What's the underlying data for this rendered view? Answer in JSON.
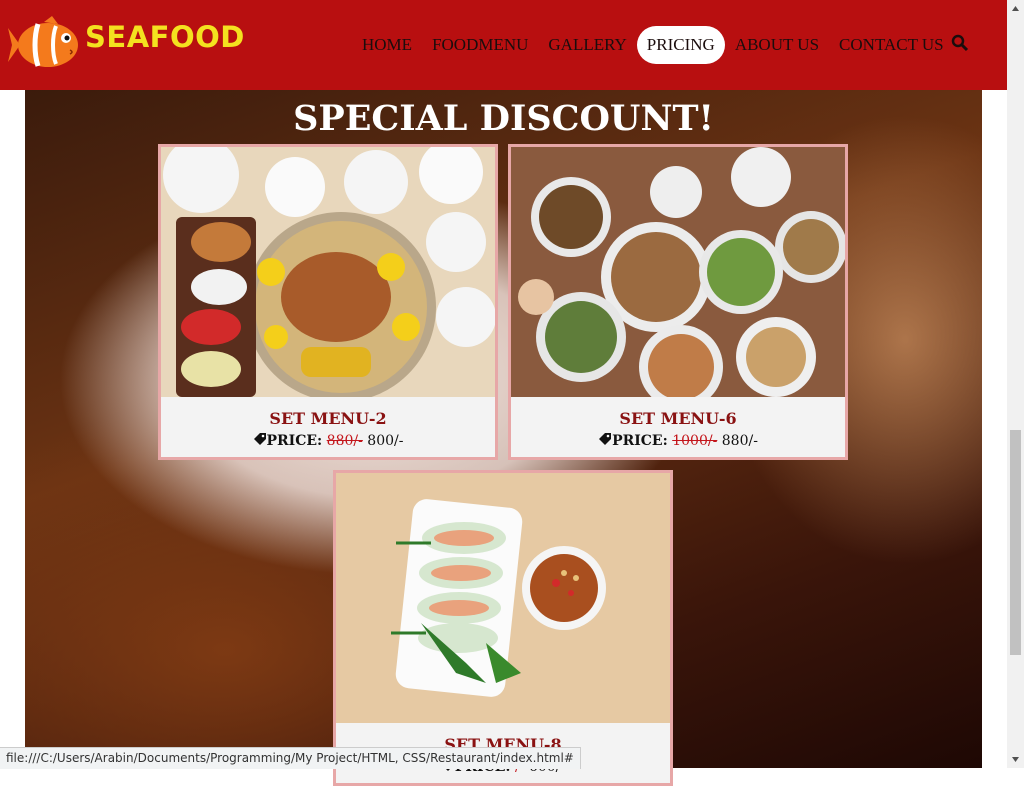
{
  "logo": {
    "text": "SEAFOOD"
  },
  "nav": {
    "items": [
      {
        "label": "HOME"
      },
      {
        "label": "FOODMENU"
      },
      {
        "label": "GALLERY"
      },
      {
        "label": "PRICING",
        "active": true
      },
      {
        "label": "ABOUT US"
      },
      {
        "label": "CONTACT US"
      }
    ],
    "search_icon": "search-icon"
  },
  "section": {
    "title": "SPECIAL DISCOUNT!"
  },
  "cards": [
    {
      "name": "SET MENU-2",
      "price_label": "PRICE:",
      "old_price": "880/-",
      "new_price": "800/-",
      "image": "platter-with-fries-chicken-rice"
    },
    {
      "name": "SET MENU-6",
      "price_label": "PRICE:",
      "old_price": "1000/-",
      "new_price": "880/-",
      "image": "table-of-assorted-dishes"
    },
    {
      "name": "SET MENU-8",
      "price_label": "PRICE:",
      "old_price": "/-",
      "new_price": "600/-",
      "image": "spring-rolls-with-dipping-sauce"
    }
  ],
  "colors": {
    "navbar": "#b80f10",
    "logo_text": "#f4e11f",
    "card_border": "#e7a7a7",
    "menu_name": "#8a1212",
    "old_price": "#c3151b"
  },
  "statusbar": {
    "url": "file:///C:/Users/Arabin/Documents/Programming/My Project/HTML, CSS/Restaurant/index.html#"
  }
}
